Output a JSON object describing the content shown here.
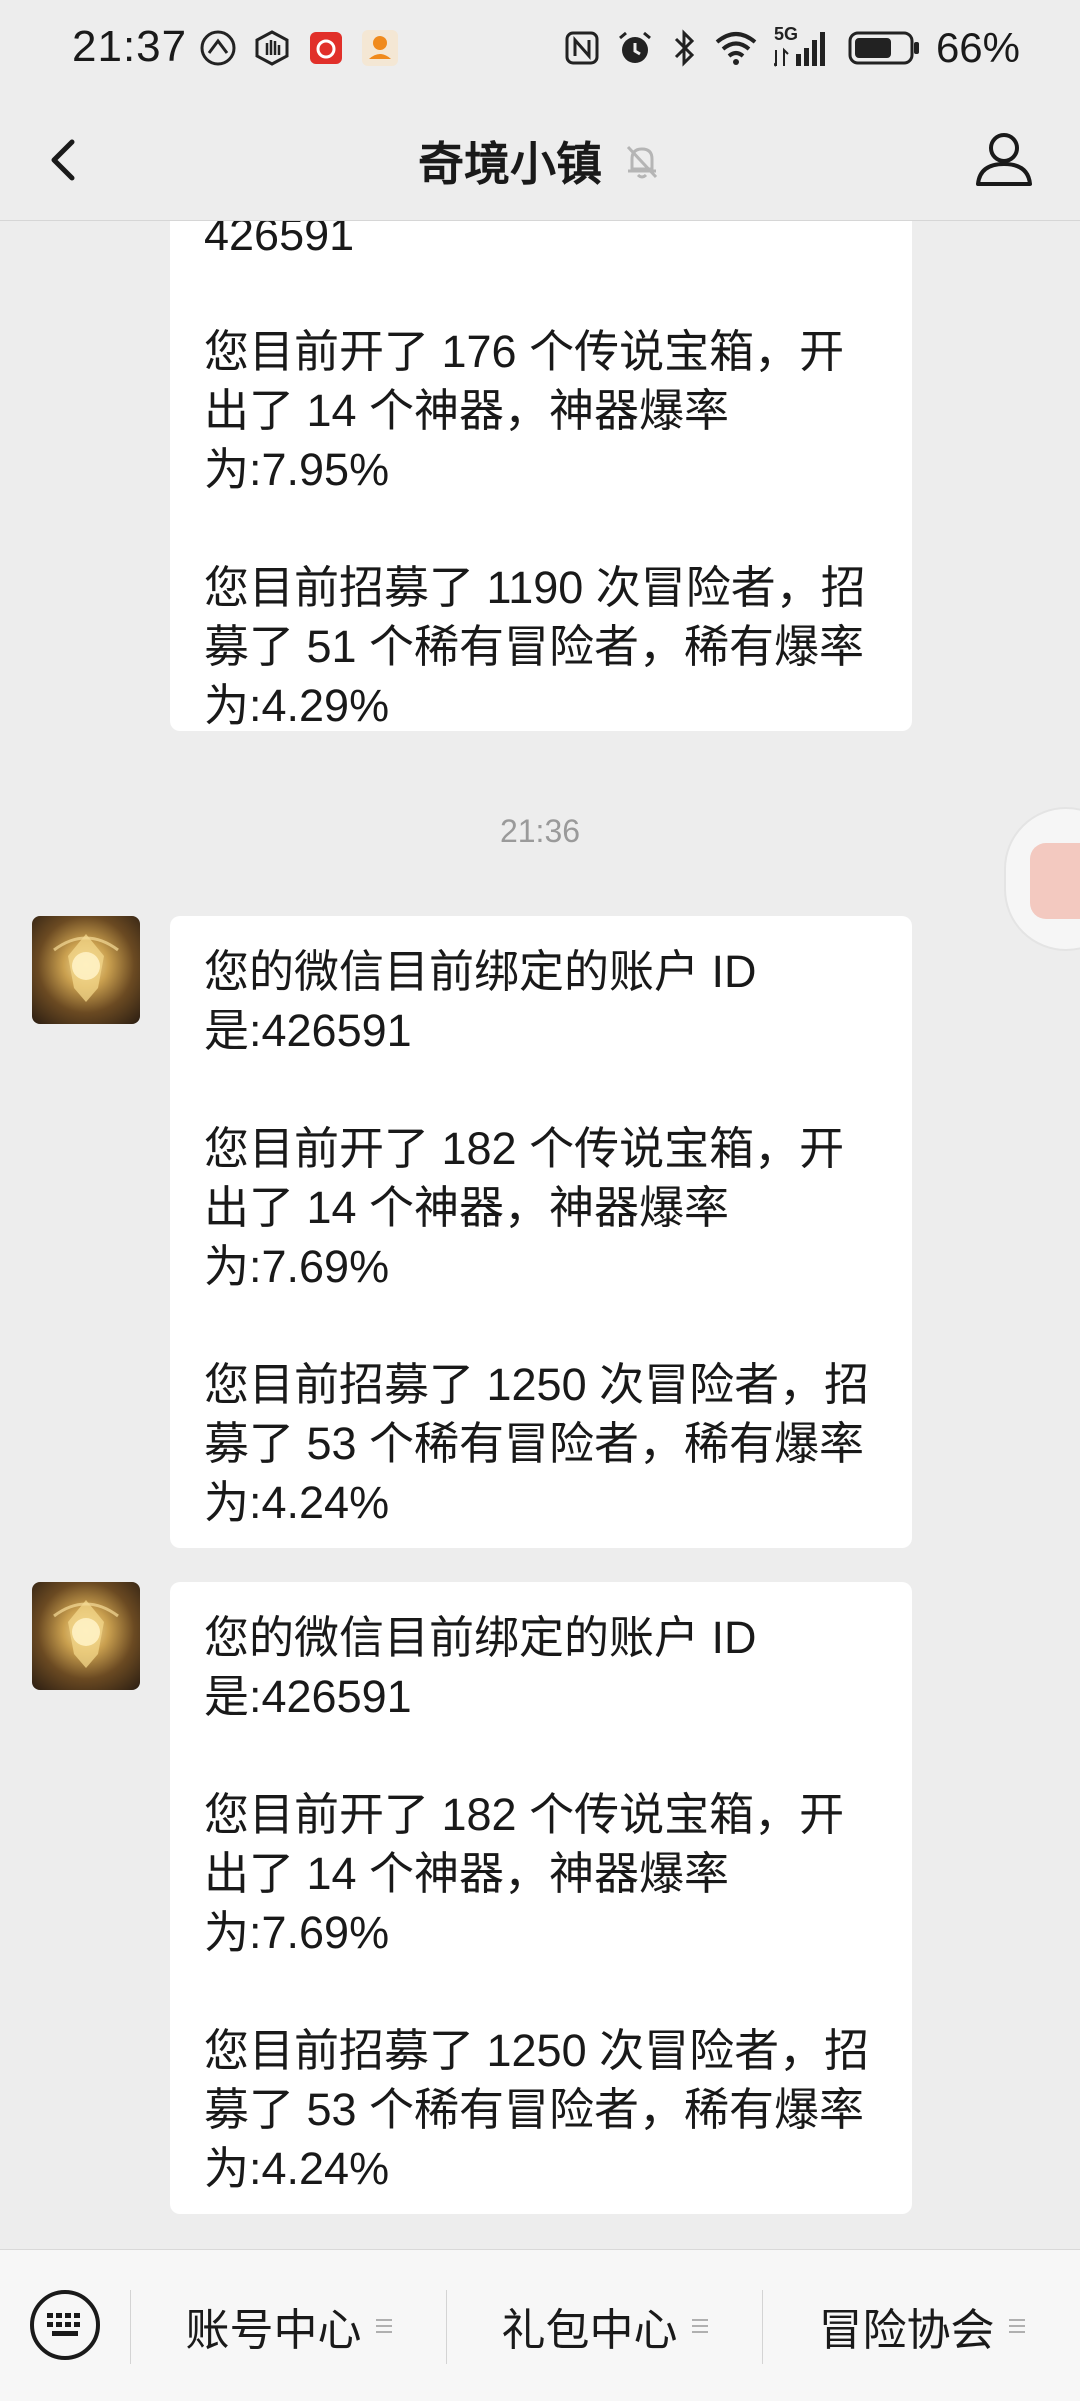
{
  "status_bar": {
    "time": "21:37",
    "battery_percent": "66%",
    "network_label": "5G",
    "icons_left": [
      "speed-app-icon",
      "hand-icon",
      "netease-music-icon",
      "mascot-app-icon"
    ],
    "icons_right": [
      "nfc-icon",
      "alarm-icon",
      "bluetooth-icon",
      "wifi-icon",
      "signal-icon",
      "battery-icon"
    ]
  },
  "header": {
    "title": "奇境小镇",
    "muted_icon": "bell-off-icon",
    "back_icon": "chevron-left-icon",
    "profile_icon": "user-icon"
  },
  "messages": [
    {
      "paragraphs": [
        "您目前开了 176 个传说宝箱，开出了 14 个神器，神器爆率为:7.95%",
        "您目前招募了 1190 次冒险者，招募了 51 个稀有冒险者，稀有爆率为:4.29%"
      ],
      "partial_top_text": "426591"
    },
    {
      "timestamp": "21:36",
      "paragraphs": [
        "您的微信目前绑定的账户 ID 是:426591",
        "您目前开了 182 个传说宝箱，开出了 14 个神器，神器爆率为:7.69%",
        "您目前招募了 1250 次冒险者，招募了 53 个稀有冒险者，稀有爆率为:4.24%"
      ]
    },
    {
      "paragraphs": [
        "您的微信目前绑定的账户 ID 是:426591",
        "您目前开了 182 个传说宝箱，开出了 14 个神器，神器爆率为:7.69%",
        "您目前招募了 1250 次冒险者，招募了 53 个稀有冒险者，稀有爆率为:4.24%"
      ]
    }
  ],
  "bottom_menu": {
    "keyboard_icon": "keyboard-icon",
    "items": [
      "账号中心",
      "礼包中心",
      "冒险协会"
    ]
  },
  "colors": {
    "background": "#ededed",
    "bubble": "#ffffff",
    "text": "#191919",
    "timestamp": "#9a9a9a"
  }
}
